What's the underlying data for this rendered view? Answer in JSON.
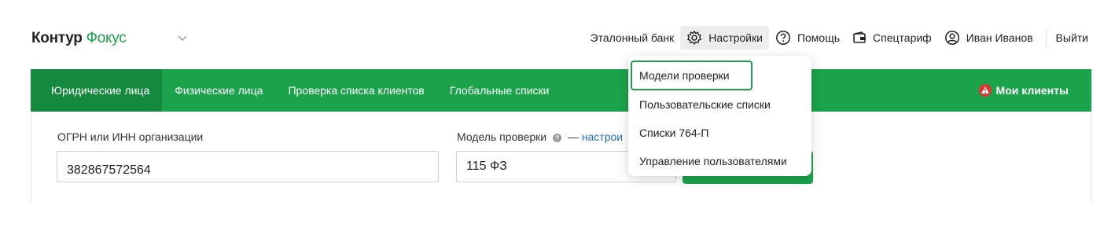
{
  "header": {
    "logo_brand": "Контур",
    "logo_product": "Фокус",
    "nav": {
      "bank": "Эталонный банк",
      "settings": "Настройки",
      "help": "Помощь",
      "tariff": "Спецтариф",
      "user": "Иван Иванов",
      "logout": "Выйти"
    }
  },
  "tabs": [
    {
      "label": "Юридические лица",
      "active": true
    },
    {
      "label": "Физические лица"
    },
    {
      "label": "Проверка списка клиентов"
    },
    {
      "label": "Глобальные списки"
    }
  ],
  "my_clients": "Мои клиенты",
  "form": {
    "ogrn_label": "ОГРН или ИНН организации",
    "ogrn_value": "382867572564",
    "model_label": "Модель проверки",
    "model_label_dash": "—",
    "model_link": "настрои",
    "model_value": "115 ФЗ"
  },
  "dropdown": {
    "items": [
      "Модели проверки",
      "Пользовательские списки",
      "Списки 764-П",
      "Управление пользователями"
    ],
    "highlighted": "Модели проверки"
  },
  "colors": {
    "accent": "#1aa34a",
    "tab_active": "#158a3e",
    "link": "#1f6fd1",
    "alert": "#e5322d"
  }
}
